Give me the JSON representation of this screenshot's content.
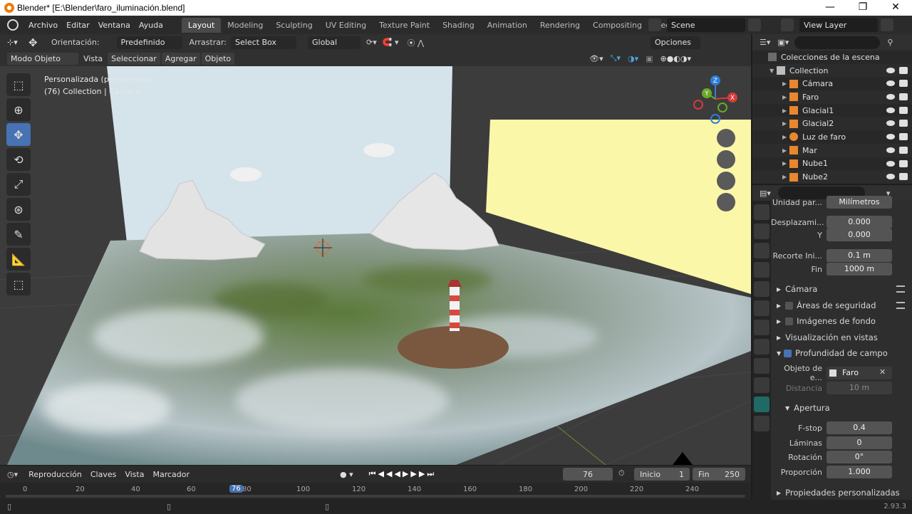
{
  "window": {
    "title": "Blender* [E:\\Blender\\faro_iluminación.blend]",
    "minimize": "—",
    "maximize": "❐",
    "close": "✕"
  },
  "menu": {
    "items": [
      "Archivo",
      "Editar",
      "Ventana",
      "Ayuda"
    ]
  },
  "workspaces": [
    "Layout",
    "Modeling",
    "Sculpting",
    "UV Editing",
    "Texture Paint",
    "Shading",
    "Animation",
    "Rendering",
    "Compositing",
    "Geo"
  ],
  "scene": {
    "name": "Scene",
    "view_layer": "View Layer"
  },
  "tool_header": {
    "orientation_label": "Orientación:",
    "orientation_value": "Predefinido",
    "drag_label": "Arrastrar:",
    "drag_value": "Select Box",
    "transform_value": "Global",
    "options": "Opciones"
  },
  "viewport_header": {
    "mode": "Modo Objeto",
    "view": "Vista",
    "select": "Seleccionar",
    "add": "Agregar",
    "object": "Objeto"
  },
  "viewport": {
    "info_line1": "Personalizada (perspectiva)",
    "info_line2": "(76) Collection | Cámara"
  },
  "gizmo": {
    "x": "X",
    "y": "Y",
    "z": "Z"
  },
  "timeline": {
    "playback": "Reproducción",
    "keys": "Claves",
    "view": "Vista",
    "marker": "Marcador",
    "current_frame": "76",
    "start_label": "Inicio",
    "start": "1",
    "end_label": "Fin",
    "end": "250",
    "ticks": [
      "0",
      "20",
      "40",
      "60",
      "80",
      "100",
      "120",
      "140",
      "160",
      "180",
      "200",
      "220",
      "240"
    ],
    "playhead": "76"
  },
  "status": {
    "version": "2.93.3"
  },
  "outliner": {
    "root": "Colecciones de la escena",
    "collection": "Collection",
    "items": [
      "Cámara",
      "Faro",
      "Glacial1",
      "Glacial2",
      "Luz de faro",
      "Mar",
      "Nube1",
      "Nube2"
    ]
  },
  "properties": {
    "unit_label": "Unidad par...",
    "unit_value": "Milímetros",
    "shift_label": "Desplazami...",
    "shift_x": "0.000",
    "shift_y_label": "Y",
    "shift_y": "0.000",
    "clip_start_label": "Recorte Ini...",
    "clip_start": "0.1 m",
    "clip_end_label": "Fin",
    "clip_end": "1000 m",
    "sections": [
      "Cámara",
      "Áreas de seguridad",
      "Imágenes de fondo",
      "Visualización en vistas",
      "Profundidad de campo"
    ],
    "focus_obj_label": "Objeto de e...",
    "focus_obj": "Faro",
    "distance_label": "Distancia",
    "distance": "10 m",
    "aperture_section": "Apertura",
    "fstop_label": "F-stop",
    "fstop": "0.4",
    "blades_label": "Láminas",
    "blades": "0",
    "rotation_label": "Rotación",
    "rotation": "0°",
    "ratio_label": "Proporción",
    "ratio": "1.000",
    "custom_props": "Propiedades personalizadas"
  }
}
